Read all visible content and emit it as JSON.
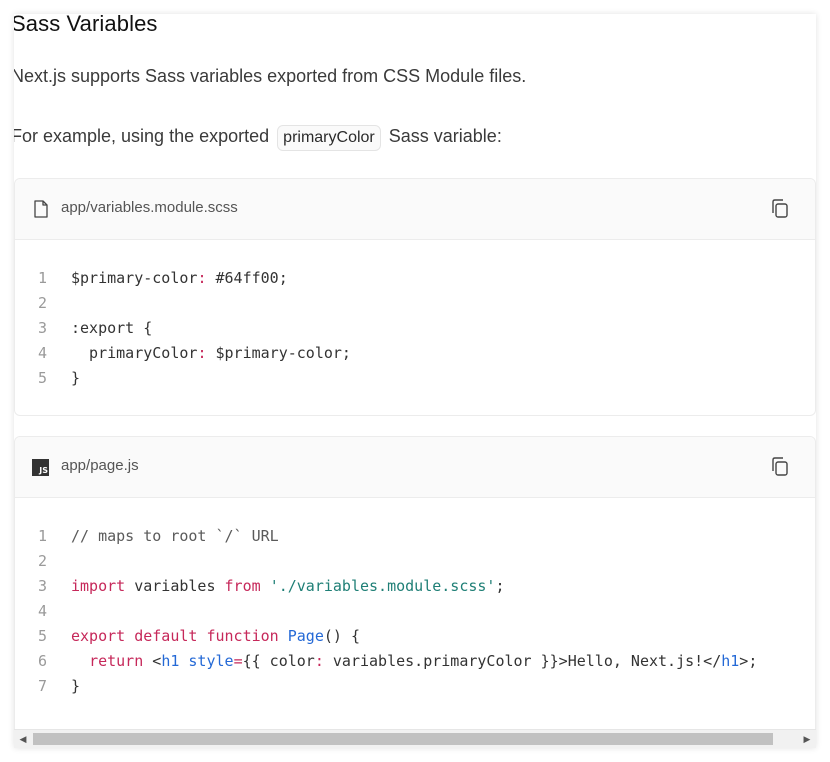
{
  "heading": "Sass Variables",
  "intro": "Next.js supports Sass variables exported from CSS Module files.",
  "example": {
    "before": "For example, using the exported",
    "code": "primaryColor",
    "after": "Sass variable:"
  },
  "file1": {
    "icon": "file-icon",
    "name": "app/variables.module.scss",
    "lines": [
      {
        "num": "1",
        "segs": [
          {
            "t": "$primary-color",
            "c": ""
          },
          {
            "t": ":",
            "c": "punc"
          },
          {
            "t": " #64ff00;",
            "c": ""
          }
        ]
      },
      {
        "num": "2",
        "segs": []
      },
      {
        "num": "3",
        "segs": [
          {
            "t": ":export {",
            "c": ""
          }
        ]
      },
      {
        "num": "4",
        "segs": [
          {
            "t": "  primaryColor",
            "c": ""
          },
          {
            "t": ":",
            "c": "punc"
          },
          {
            "t": " $primary-color;",
            "c": ""
          }
        ]
      },
      {
        "num": "5",
        "segs": [
          {
            "t": "}",
            "c": ""
          }
        ]
      }
    ]
  },
  "file2": {
    "icon": "js-icon",
    "icon_label": "JS",
    "name": "app/page.js",
    "lines": [
      {
        "num": "1",
        "segs": [
          {
            "t": "// maps to root `/` URL",
            "c": "cm"
          }
        ]
      },
      {
        "num": "2",
        "segs": []
      },
      {
        "num": "3",
        "segs": [
          {
            "t": "import",
            "c": "kw"
          },
          {
            "t": " variables ",
            "c": ""
          },
          {
            "t": "from",
            "c": "kw"
          },
          {
            "t": " ",
            "c": ""
          },
          {
            "t": "'./variables.module.scss'",
            "c": "str"
          },
          {
            "t": ";",
            "c": ""
          }
        ]
      },
      {
        "num": "4",
        "segs": []
      },
      {
        "num": "5",
        "segs": [
          {
            "t": "export",
            "c": "kw"
          },
          {
            "t": " ",
            "c": ""
          },
          {
            "t": "default",
            "c": "kw"
          },
          {
            "t": " ",
            "c": ""
          },
          {
            "t": "function",
            "c": "kw"
          },
          {
            "t": " ",
            "c": ""
          },
          {
            "t": "Page",
            "c": "fn"
          },
          {
            "t": "() {",
            "c": ""
          }
        ]
      },
      {
        "num": "6",
        "segs": [
          {
            "t": "  ",
            "c": ""
          },
          {
            "t": "return",
            "c": "kw"
          },
          {
            "t": " <",
            "c": ""
          },
          {
            "t": "h1",
            "c": "tag"
          },
          {
            "t": " ",
            "c": ""
          },
          {
            "t": "style",
            "c": "tag"
          },
          {
            "t": "=",
            "c": "punc"
          },
          {
            "t": "{{ color",
            "c": ""
          },
          {
            "t": ":",
            "c": "punc"
          },
          {
            "t": " variables.primaryColor }}>Hello, Next.js!</",
            "c": ""
          },
          {
            "t": "h1",
            "c": "tag"
          },
          {
            "t": ">;",
            "c": ""
          }
        ]
      },
      {
        "num": "7",
        "segs": [
          {
            "t": "}",
            "c": ""
          }
        ]
      }
    ]
  },
  "scrollbar": {
    "left_arrow": "◀",
    "right_arrow": "▶"
  }
}
